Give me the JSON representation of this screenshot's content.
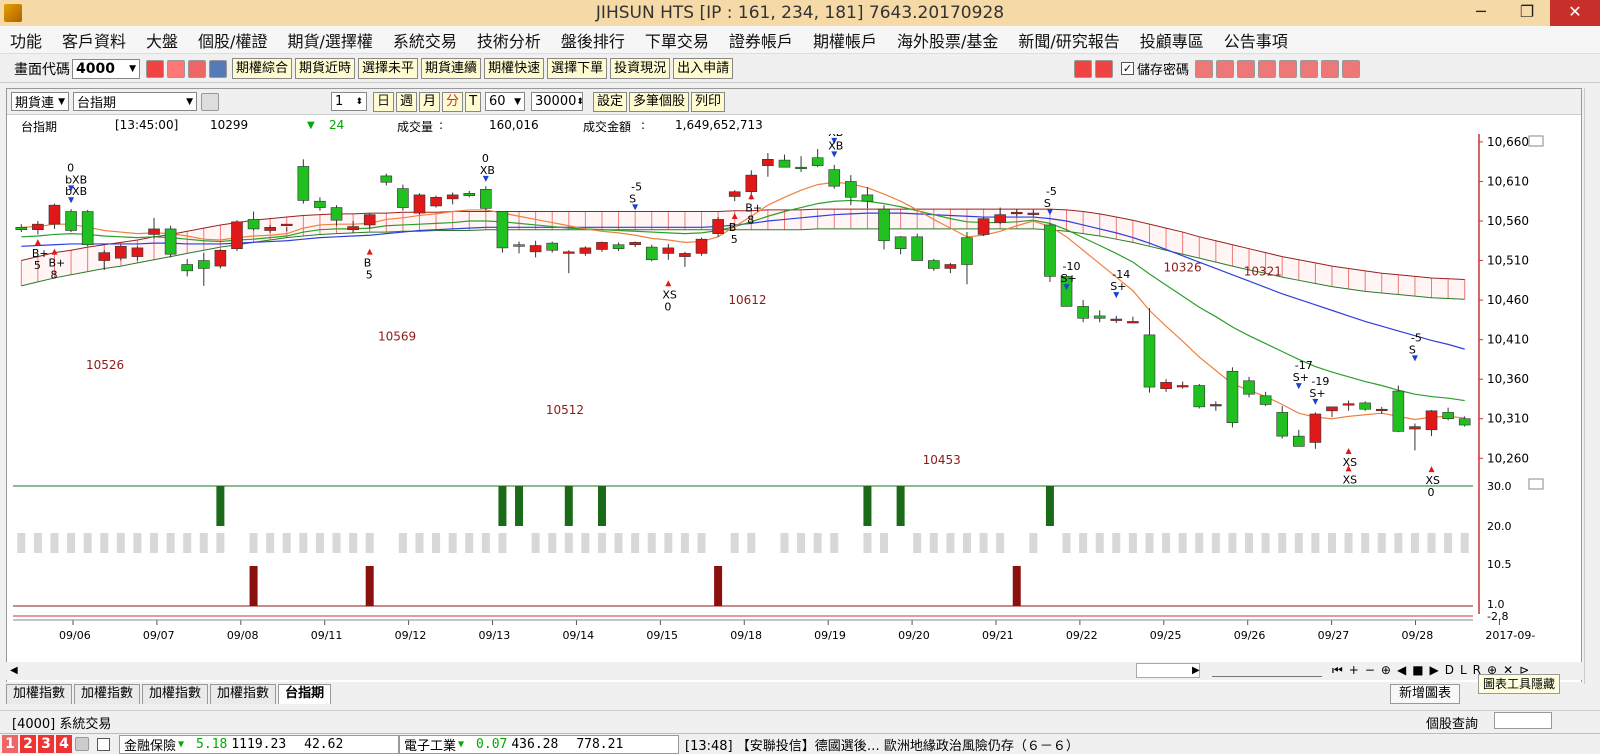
{
  "window": {
    "title": "JIHSUN HTS     [IP : 161, 234, 181] 7643.20170928",
    "minimize": "─",
    "maximize": "❐",
    "close": "✕"
  },
  "menu": [
    "功能",
    "客戶資料",
    "大盤",
    "個股/權證",
    "期貨/選擇權",
    "系統交易",
    "技術分析",
    "盤後排行",
    "下單交易",
    "證券帳戶",
    "期權帳戶",
    "海外股票/基金",
    "新聞/研究報告",
    "投顧專區",
    "公告事項"
  ],
  "toolbar": {
    "code_label": "畫面代碼",
    "code_value": "4000",
    "buttons": [
      "期權綜合",
      "期貨近時",
      "選擇未平",
      "期貨連續",
      "期權快速",
      "選擇下單",
      "投資現況",
      "出入申請"
    ],
    "save_password": "儲存密碼"
  },
  "chart_controls": {
    "type": "期貨連",
    "symbol": "台指期",
    "count": "1",
    "period_buttons": [
      "日",
      "週",
      "月",
      "分",
      "T"
    ],
    "interval": "60",
    "bars": "30000",
    "setting": "設定",
    "multi": "多筆個股",
    "print": "列印"
  },
  "info": {
    "name": "台指期",
    "time": "[13:45:00]",
    "price": "10299",
    "arrow": "▼",
    "change": "24",
    "volume_label": "成交量",
    "colon": ":",
    "volume": "160,016",
    "amount_label": "成交金額",
    "amount": "1,649,652,713"
  },
  "chart_data": {
    "type": "candlestick",
    "price_axis": [
      "10,660",
      "10,610",
      "10,560",
      "10,510",
      "10,460",
      "10,410",
      "10,360",
      "10,310",
      "10,260"
    ],
    "price_range": [
      10230,
      10670
    ],
    "indicator_axis": [
      "30.0",
      "20.0",
      "10.5",
      "1.0",
      "-2.8"
    ],
    "dates": [
      "09/06",
      "09/07",
      "09/08",
      "09/11",
      "09/12",
      "09/13",
      "09/14",
      "09/15",
      "09/18",
      "09/19",
      "09/20",
      "09/21",
      "09/22",
      "09/25",
      "09/26",
      "09/27",
      "09/28",
      "2017-09-"
    ],
    "candles": [
      [
        10552,
        10556,
        10546,
        10549
      ],
      [
        10549,
        10560,
        10543,
        10556
      ],
      [
        10556,
        10582,
        10550,
        10580
      ],
      [
        10572,
        10575,
        10546,
        10548
      ],
      [
        10572,
        10574,
        10528,
        10530
      ],
      [
        10510,
        10523,
        10498,
        10520
      ],
      [
        10513,
        10530,
        10510,
        10528
      ],
      [
        10515,
        10528,
        10510,
        10526
      ],
      [
        10543,
        10564,
        10538,
        10550
      ],
      [
        10550,
        10554,
        10514,
        10518
      ],
      [
        10505,
        10512,
        10490,
        10497
      ],
      [
        10510,
        10520,
        10478,
        10500
      ],
      [
        10503,
        10525,
        10500,
        10523
      ],
      [
        10525,
        10561,
        10522,
        10559
      ],
      [
        10562,
        10572,
        10548,
        10550
      ],
      [
        10548,
        10555,
        10545,
        10552
      ],
      [
        10556,
        10552,
        10547,
        10556
      ],
      [
        10629,
        10638,
        10582,
        10586
      ],
      [
        10585,
        10590,
        10573,
        10577
      ],
      [
        10577,
        10580,
        10554,
        10561
      ],
      [
        10549,
        10560,
        10545,
        10553
      ],
      [
        10555,
        10570,
        10550,
        10568
      ],
      [
        10617,
        10620,
        10605,
        10609
      ],
      [
        10601,
        10606,
        10573,
        10577
      ],
      [
        10570,
        10595,
        10568,
        10593
      ],
      [
        10579,
        10592,
        10577,
        10590
      ],
      [
        10588,
        10596,
        10581,
        10593
      ],
      [
        10595,
        10598,
        10590,
        10592
      ],
      [
        10600,
        10604,
        10573,
        10576
      ],
      [
        10572,
        10572,
        10520,
        10526
      ],
      [
        10530,
        10534,
        10519,
        10528
      ],
      [
        10521,
        10535,
        10514,
        10529
      ],
      [
        10532,
        10534,
        10520,
        10523
      ],
      [
        10519,
        10523,
        10494,
        10521
      ],
      [
        10519,
        10528,
        10516,
        10526
      ],
      [
        10524,
        10534,
        10521,
        10533
      ],
      [
        10530,
        10533,
        10522,
        10525
      ],
      [
        10530,
        10534,
        10527,
        10533
      ],
      [
        10527,
        10530,
        10509,
        10511
      ],
      [
        10519,
        10531,
        10511,
        10526
      ],
      [
        10515,
        10521,
        10502,
        10519
      ],
      [
        10519,
        10539,
        10516,
        10537
      ],
      [
        10544,
        10565,
        10540,
        10562
      ],
      [
        10591,
        10599,
        10585,
        10597
      ],
      [
        10597,
        10624,
        10587,
        10618
      ],
      [
        10630,
        10646,
        10616,
        10638
      ],
      [
        10637,
        10644,
        10628,
        10628
      ],
      [
        10628,
        10642,
        10622,
        10627
      ],
      [
        10640,
        10651,
        10628,
        10630
      ],
      [
        10625,
        10631,
        10601,
        10604
      ],
      [
        10610,
        10618,
        10580,
        10590
      ],
      [
        10593,
        10603,
        10576,
        10585
      ],
      [
        10575,
        10580,
        10524,
        10535
      ],
      [
        10540,
        10541,
        10518,
        10525
      ],
      [
        10540,
        10544,
        10510,
        10510
      ],
      [
        10510,
        10512,
        10497,
        10500
      ],
      [
        10500,
        10507,
        10494,
        10505
      ],
      [
        10539,
        10546,
        10480,
        10505
      ],
      [
        10543,
        10565,
        10541,
        10563
      ],
      [
        10558,
        10577,
        10556,
        10568
      ],
      [
        10570,
        10575,
        10566,
        10571
      ],
      [
        10570,
        10574,
        10566,
        10570
      ],
      [
        10555,
        10557,
        10483,
        10490
      ],
      [
        10490,
        10492,
        10452,
        10452
      ],
      [
        10452,
        10460,
        10432,
        10437
      ],
      [
        10440,
        10447,
        10432,
        10437
      ],
      [
        10436,
        10440,
        10431,
        10436
      ],
      [
        10431,
        10439,
        10432,
        10433
      ],
      [
        10416,
        10450,
        10343,
        10350
      ],
      [
        10348,
        10360,
        10344,
        10356
      ],
      [
        10352,
        10357,
        10348,
        10352
      ],
      [
        10352,
        10354,
        10323,
        10325
      ],
      [
        10328,
        10332,
        10320,
        10328
      ],
      [
        10370,
        10375,
        10299,
        10305
      ],
      [
        10358,
        10363,
        10337,
        10341
      ],
      [
        10339,
        10344,
        10326,
        10328
      ],
      [
        10318,
        10326,
        10285,
        10288
      ],
      [
        10288,
        10296,
        10275,
        10275
      ],
      [
        10280,
        10318,
        10272,
        10316
      ],
      [
        10320,
        10325,
        10312,
        10325
      ],
      [
        10328,
        10333,
        10320,
        10329
      ],
      [
        10330,
        10332,
        10320,
        10322
      ],
      [
        10322,
        10325,
        10316,
        10322
      ],
      [
        10345,
        10352,
        10293,
        10294
      ],
      [
        10297,
        10304,
        10270,
        10300
      ],
      [
        10296,
        10321,
        10288,
        10320
      ],
      [
        10318,
        10324,
        10308,
        10310
      ],
      [
        10310,
        10313,
        10300,
        10302
      ]
    ],
    "ma_orange": [
      10552,
      10553,
      10556,
      10556,
      10552,
      10548,
      10546,
      10544,
      10545,
      10544,
      10541,
      10537,
      10536,
      10539,
      10541,
      10542,
      10544,
      10551,
      10555,
      10556,
      10556,
      10557,
      10562,
      10564,
      10567,
      10569,
      10572,
      10574,
      10574,
      10570,
      10566,
      10562,
      10558,
      10554,
      10550,
      10547,
      10545,
      10542,
      10538,
      10536,
      10533,
      10534,
      10540,
      10553,
      10566,
      10580,
      10590,
      10599,
      10606,
      10609,
      10607,
      10602,
      10594,
      10585,
      10574,
      10562,
      10551,
      10540,
      10542,
      10547,
      10554,
      10560,
      10553,
      10540,
      10523,
      10506,
      10489,
      10472,
      10447,
      10427,
      10408,
      10388,
      10371,
      10354,
      10346,
      10338,
      10328,
      10317,
      10312,
      10310,
      10313,
      10315,
      10317,
      10313,
      10309,
      10312,
      10313,
      10311
    ],
    "ma_green": [
      10540,
      10541,
      10543,
      10544,
      10543,
      10541,
      10540,
      10539,
      10540,
      10539,
      10537,
      10535,
      10534,
      10536,
      10537,
      10539,
      10541,
      10546,
      10549,
      10550,
      10550,
      10551,
      10554,
      10555,
      10556,
      10557,
      10558,
      10560,
      10560,
      10559,
      10557,
      10555,
      10553,
      10551,
      10550,
      10549,
      10548,
      10547,
      10546,
      10545,
      10544,
      10545,
      10548,
      10553,
      10559,
      10566,
      10572,
      10577,
      10582,
      10585,
      10586,
      10585,
      10582,
      10578,
      10573,
      10568,
      10563,
      10559,
      10558,
      10558,
      10559,
      10561,
      10557,
      10549,
      10539,
      10529,
      10519,
      10508,
      10493,
      10479,
      10465,
      10451,
      10439,
      10426,
      10415,
      10405,
      10395,
      10385,
      10376,
      10369,
      10363,
      10357,
      10352,
      10346,
      10341,
      10338,
      10336,
      10333
    ],
    "ma_blue": [
      10528,
      10529,
      10530,
      10531,
      10531,
      10531,
      10531,
      10531,
      10532,
      10532,
      10531,
      10531,
      10531,
      10532,
      10533,
      10534,
      10535,
      10537,
      10539,
      10540,
      10541,
      10542,
      10544,
      10546,
      10548,
      10549,
      10550,
      10551,
      10552,
      10552,
      10552,
      10552,
      10552,
      10552,
      10552,
      10552,
      10552,
      10552,
      10552,
      10552,
      10552,
      10552,
      10553,
      10555,
      10557,
      10560,
      10562,
      10564,
      10566,
      10568,
      10569,
      10570,
      10570,
      10570,
      10569,
      10568,
      10567,
      10566,
      10565,
      10565,
      10565,
      10565,
      10563,
      10560,
      10555,
      10550,
      10545,
      10539,
      10532,
      10524,
      10516,
      10508,
      10500,
      10492,
      10484,
      10476,
      10468,
      10461,
      10454,
      10447,
      10440,
      10433,
      10427,
      10421,
      10415,
      10409,
      10404,
      10398
    ],
    "band_upper": [
      10510,
      10515,
      10520,
      10523,
      10527,
      10530,
      10533,
      10536,
      10540,
      10543,
      10547,
      10551,
      10555,
      10558,
      10561,
      10563,
      10565,
      10567,
      10568,
      10569,
      10569,
      10570,
      10570,
      10571,
      10571,
      10571,
      10572,
      10572,
      10572,
      10572,
      10572,
      10572,
      10572,
      10572,
      10572,
      10572,
      10572,
      10572,
      10572,
      10572,
      10572,
      10572,
      10572,
      10573,
      10573,
      10574,
      10574,
      10574,
      10575,
      10575,
      10575,
      10575,
      10575,
      10575,
      10575,
      10575,
      10575,
      10575,
      10575,
      10575,
      10575,
      10575,
      10575,
      10574,
      10572,
      10569,
      10565,
      10561,
      10556,
      10551,
      10546,
      10540,
      10535,
      10530,
      10525,
      10520,
      10515,
      10511,
      10507,
      10503,
      10500,
      10497,
      10494,
      10492,
      10490,
      10488,
      10487,
      10486
    ],
    "band_lower": [
      10478,
      10483,
      10488,
      10492,
      10496,
      10500,
      10503,
      10507,
      10511,
      10515,
      10519,
      10523,
      10527,
      10530,
      10533,
      10536,
      10539,
      10541,
      10543,
      10544,
      10545,
      10546,
      10546,
      10547,
      10547,
      10548,
      10548,
      10548,
      10549,
      10549,
      10549,
      10549,
      10549,
      10549,
      10549,
      10549,
      10549,
      10549,
      10549,
      10549,
      10549,
      10549,
      10549,
      10549,
      10549,
      10549,
      10549,
      10549,
      10550,
      10550,
      10550,
      10550,
      10550,
      10550,
      10550,
      10550,
      10550,
      10550,
      10550,
      10550,
      10550,
      10550,
      10549,
      10547,
      10544,
      10541,
      10537,
      10533,
      10528,
      10523,
      10518,
      10513,
      10508,
      10503,
      10498,
      10494,
      10489,
      10485,
      10481,
      10477,
      10474,
      10471,
      10469,
      10467,
      10465,
      10463,
      10462,
      10461
    ],
    "labels": [
      {
        "text": "10526",
        "x": 5,
        "v": 10373,
        "color": "#8b1a1a"
      },
      {
        "text": "10569",
        "x": 25,
        "v": 10409,
        "color": "#8b1a1a"
      },
      {
        "text": "10512",
        "x": 36.5,
        "v": 10316,
        "color": "#8b1a1a"
      },
      {
        "text": "10612",
        "x": 49,
        "v": 10455,
        "color": "#8b1a1a"
      },
      {
        "text": "10453",
        "x": 62.3,
        "v": 10253,
        "color": "#8b1a1a"
      },
      {
        "text": "10326",
        "x": 78.8,
        "v": 10496,
        "color": "#8b1a1a"
      },
      {
        "text": "10321",
        "x": 84.3,
        "v": 10491,
        "color": "#8b1a1a"
      }
    ],
    "signals": [
      {
        "i": 3,
        "text": "bXB",
        "dir": "down",
        "v": 10600,
        "extra": "0"
      },
      {
        "i": 3,
        "text": "bXB",
        "dir": "down",
        "v": 10585
      },
      {
        "i": 1,
        "text": "B+",
        "dir": "up",
        "v": 10532,
        "extra": "5"
      },
      {
        "i": 2,
        "text": "B+",
        "dir": "up",
        "v": 10520,
        "extra": "8"
      },
      {
        "i": 21,
        "text": "B",
        "dir": "up",
        "v": 10520,
        "extra": "5"
      },
      {
        "i": 28,
        "text": "XB",
        "dir": "down",
        "v": 10612,
        "extra": "0"
      },
      {
        "i": 37,
        "text": "S",
        "dir": "down",
        "v": 10576,
        "extra": "-5"
      },
      {
        "i": 39,
        "text": "XS",
        "dir": "up",
        "v": 10480,
        "extra": "0"
      },
      {
        "i": 43,
        "text": "B",
        "dir": "up",
        "v": 10565,
        "extra": "5"
      },
      {
        "i": 44,
        "text": "B+",
        "dir": "up",
        "v": 10590,
        "extra": "8"
      },
      {
        "i": 49,
        "text": "XB",
        "dir": "down",
        "v": 10660
      },
      {
        "i": 49,
        "text": "XB",
        "dir": "down",
        "v": 10643
      },
      {
        "i": 62,
        "text": "S",
        "dir": "down",
        "v": 10570,
        "extra": "-5"
      },
      {
        "i": 63,
        "text": "S+",
        "dir": "down",
        "v": 10475,
        "extra": "-10"
      },
      {
        "i": 66,
        "text": "S+",
        "dir": "down",
        "v": 10465,
        "extra": "-14"
      },
      {
        "i": 77,
        "text": "S+",
        "dir": "down",
        "v": 10350,
        "extra": "-17"
      },
      {
        "i": 78,
        "text": "S+",
        "dir": "down",
        "v": 10330,
        "extra": "-19"
      },
      {
        "i": 80,
        "text": "XS",
        "dir": "up",
        "v": 10268
      },
      {
        "i": 80,
        "text": "XS",
        "dir": "up",
        "v": 10246
      },
      {
        "i": 84,
        "text": "S",
        "dir": "down",
        "v": 10385,
        "extra": "-5"
      },
      {
        "i": 85,
        "text": "XS",
        "dir": "up",
        "v": 10245,
        "extra": "0"
      }
    ],
    "ind_green": [
      12,
      29,
      30,
      33,
      35,
      51,
      53,
      62
    ],
    "ind_red": [
      14,
      21,
      42,
      60
    ],
    "ind_gray_gaps": [
      13,
      22,
      30,
      42,
      45,
      50,
      53,
      60,
      62
    ]
  },
  "bottom_tabs": [
    "加權指數",
    "加權指數",
    "加權指數",
    "加權指數",
    "台指期"
  ],
  "add_chart": "新增圖表",
  "hide_tools": "圖表工具隱藏",
  "window_tab": "[4000] 系統交易",
  "stock_query": "個股查詢",
  "ticker": {
    "nums": [
      "1",
      "2",
      "3",
      "4"
    ],
    "s1_name": "金融保險",
    "s1_arrow": "▼",
    "s1_chg": "5.18",
    "s1_val": "1119.23",
    "s1_vol": "42.62",
    "s2_name": "電子工業",
    "s2_arrow": "▼",
    "s2_chg": "0.07",
    "s2_val": "436.28",
    "s2_vol": "778.21",
    "news": "[13:48] 【安聯投信】德國選後… 歐洲地緣政治風險仍存（６－６）"
  }
}
